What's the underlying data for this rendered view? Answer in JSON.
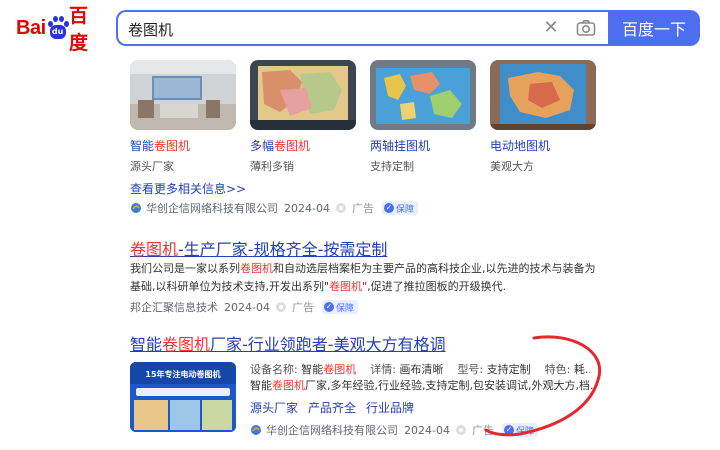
{
  "logo": {
    "bai": "Bai",
    "du": "du",
    "cn": "百度"
  },
  "search": {
    "query": "卷图机",
    "button_label": "百度一下"
  },
  "cards": [
    {
      "title_pre": "智能",
      "title_hl": "卷图机",
      "title_post": "",
      "sub": "源头厂家"
    },
    {
      "title_pre": "多幅",
      "title_hl": "卷图机",
      "title_post": "",
      "sub": "薄利多销"
    },
    {
      "title_pre": "两轴挂图机",
      "title_hl": "",
      "title_post": "",
      "sub": "支持定制"
    },
    {
      "title_pre": "电动地图机",
      "title_hl": "",
      "title_post": "",
      "sub": "美观大方"
    }
  ],
  "more_link": "查看更多相关信息>>",
  "source1": {
    "company": "华创企信网络科技有限公司",
    "date": "2024-04",
    "ad": "广告",
    "protect": "保障"
  },
  "result1": {
    "title_hl": "卷图机",
    "title_rest": "-生产厂家-规格齐全-按需定制",
    "desc_a": "我们公司是一家以系列",
    "desc_hl1": "卷图机",
    "desc_b": "和自动选层档案柜为主要产品的高科技企业,以先进的技术与装备为",
    "desc_c": "基础,以科研单位为技术支持,开发出系列\"",
    "desc_hl2": "卷图机",
    "desc_d": "\",促进了推拉图板的开级换代.",
    "source": {
      "company": "邦企汇聚信息技术",
      "date": "2024-04",
      "ad": "广告",
      "protect": "保障"
    }
  },
  "result2": {
    "title_pre": "智能",
    "title_hl": "卷图机",
    "title_post": "厂家-行业领跑者-美观大方有格调",
    "thumb_text": "15年专注电动卷图机",
    "attrs": {
      "k1": "设备名称:",
      "v1_pre": "智能",
      "v1_hl": "卷图机",
      "k2": "详情:",
      "v2": "画布清晰",
      "k3": "型号:",
      "v3": "支持定制",
      "k4": "特色:",
      "v4": "耗..."
    },
    "desc_pre": "智能",
    "desc_hl": "卷图机",
    "desc_post": "厂家,多年经验,行业经验,支持定制,包安装调试,外观大方,档...",
    "tags": [
      "源头厂家",
      "产品齐全",
      "行业品牌"
    ],
    "source": {
      "company": "华创企信网络科技有限公司",
      "date": "2024-04",
      "ad": "广告",
      "protect": "保障"
    }
  },
  "colors": {
    "accent": "#4e6ef2",
    "link": "#2440b3",
    "highlight": "#f73131",
    "logo_red": "#e10602",
    "logo_blue": "#2932e1",
    "scribble": "#e8262b"
  }
}
